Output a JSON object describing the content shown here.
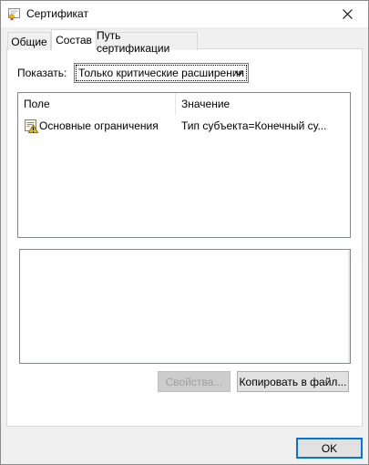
{
  "window": {
    "title": "Сертификат",
    "close_icon": "close-icon",
    "cert_icon": "certificate-icon"
  },
  "tabs": [
    {
      "label": "Общие",
      "active": false
    },
    {
      "label": "Состав",
      "active": true
    },
    {
      "label": "Путь сертификации",
      "active": false
    }
  ],
  "filter": {
    "label": "Показать:",
    "selected": "Только критические расширения"
  },
  "list": {
    "columns": [
      "Поле",
      "Значение"
    ],
    "rows": [
      {
        "icon": "extension-warning-icon",
        "field": "Основные ограничения",
        "value": "Тип субъекта=Конечный су..."
      }
    ]
  },
  "buttons": {
    "properties": "Свойства...",
    "copy_to_file": "Копировать в файл...",
    "ok": "OK"
  }
}
